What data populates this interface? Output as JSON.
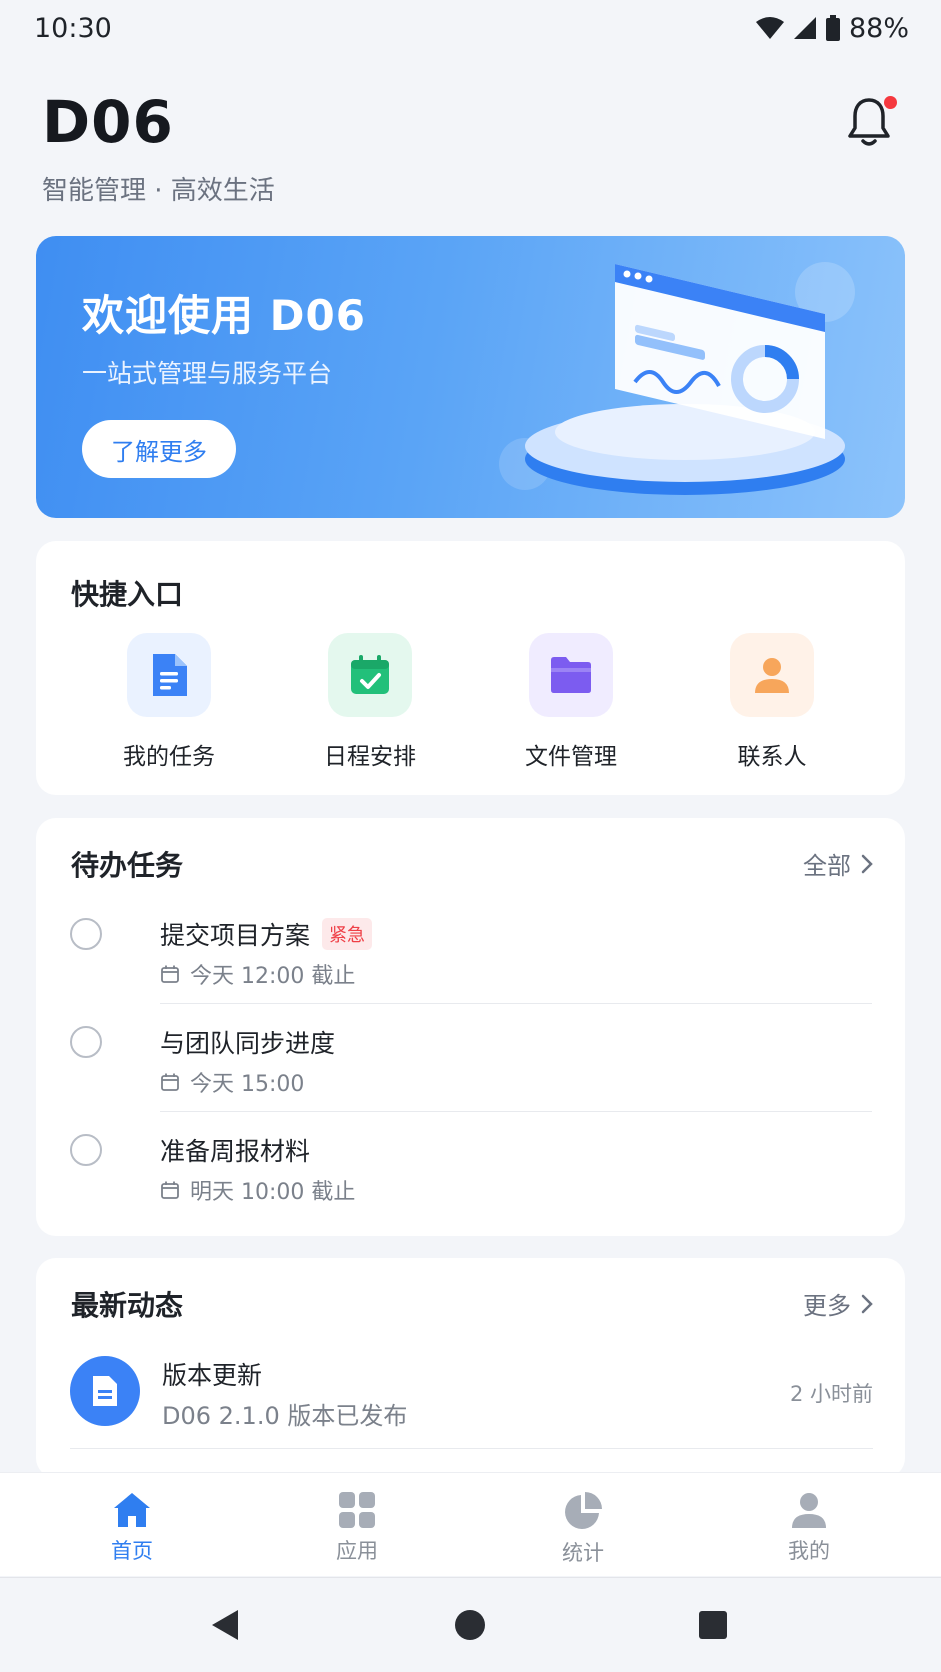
{
  "status_bar": {
    "time": "10:30",
    "battery": "88%"
  },
  "header": {
    "title": "D06",
    "subtitle": "智能管理 · 高效生活"
  },
  "banner": {
    "title": "欢迎使用 D06",
    "subtitle": "一站式管理与服务平台",
    "button_label": "了解更多"
  },
  "quick_access": {
    "title": "快捷入口",
    "items": [
      {
        "label": "我的任务",
        "icon": "document-icon",
        "color": "#3b82f6"
      },
      {
        "label": "日程安排",
        "icon": "calendar-check-icon",
        "color": "#22c07a"
      },
      {
        "label": "文件管理",
        "icon": "folder-icon",
        "color": "#7c5cf0"
      },
      {
        "label": "联系人",
        "icon": "person-icon",
        "color": "#f7a65b"
      }
    ]
  },
  "todo": {
    "title": "待办任务",
    "link_label": "全部",
    "items": [
      {
        "title": "提交项目方案",
        "tag": "紧急",
        "meta": "今天 12:00 截止"
      },
      {
        "title": "与团队同步进度",
        "tag": "",
        "meta": "今天 15:00"
      },
      {
        "title": "准备周报材料",
        "tag": "",
        "meta": "明天 10:00 截止"
      }
    ]
  },
  "news": {
    "title": "最新动态",
    "link_label": "更多",
    "items": [
      {
        "title": "版本更新",
        "desc": "D06 2.1.0 版本已发布",
        "time": "2 小时前"
      }
    ]
  },
  "tabbar": {
    "items": [
      {
        "label": "首页",
        "icon": "home-icon",
        "active": true
      },
      {
        "label": "应用",
        "icon": "apps-grid-icon",
        "active": false
      },
      {
        "label": "统计",
        "icon": "pie-chart-icon",
        "active": false
      },
      {
        "label": "我的",
        "icon": "profile-icon",
        "active": false
      }
    ]
  },
  "colors": {
    "accent": "#2f7ef0",
    "urgent": "#ef3f46",
    "notification_dot": "#f5383f"
  }
}
